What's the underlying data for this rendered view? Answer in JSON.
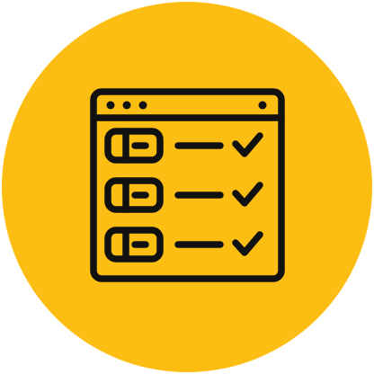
{
  "icon": {
    "name": "browser-checklist-icon",
    "background_color": "#FDBE14",
    "stroke_color": "#111111",
    "rows": [
      {
        "name": "row-1",
        "checked": true
      },
      {
        "name": "row-2",
        "checked": true
      },
      {
        "name": "row-3",
        "checked": true
      }
    ]
  }
}
